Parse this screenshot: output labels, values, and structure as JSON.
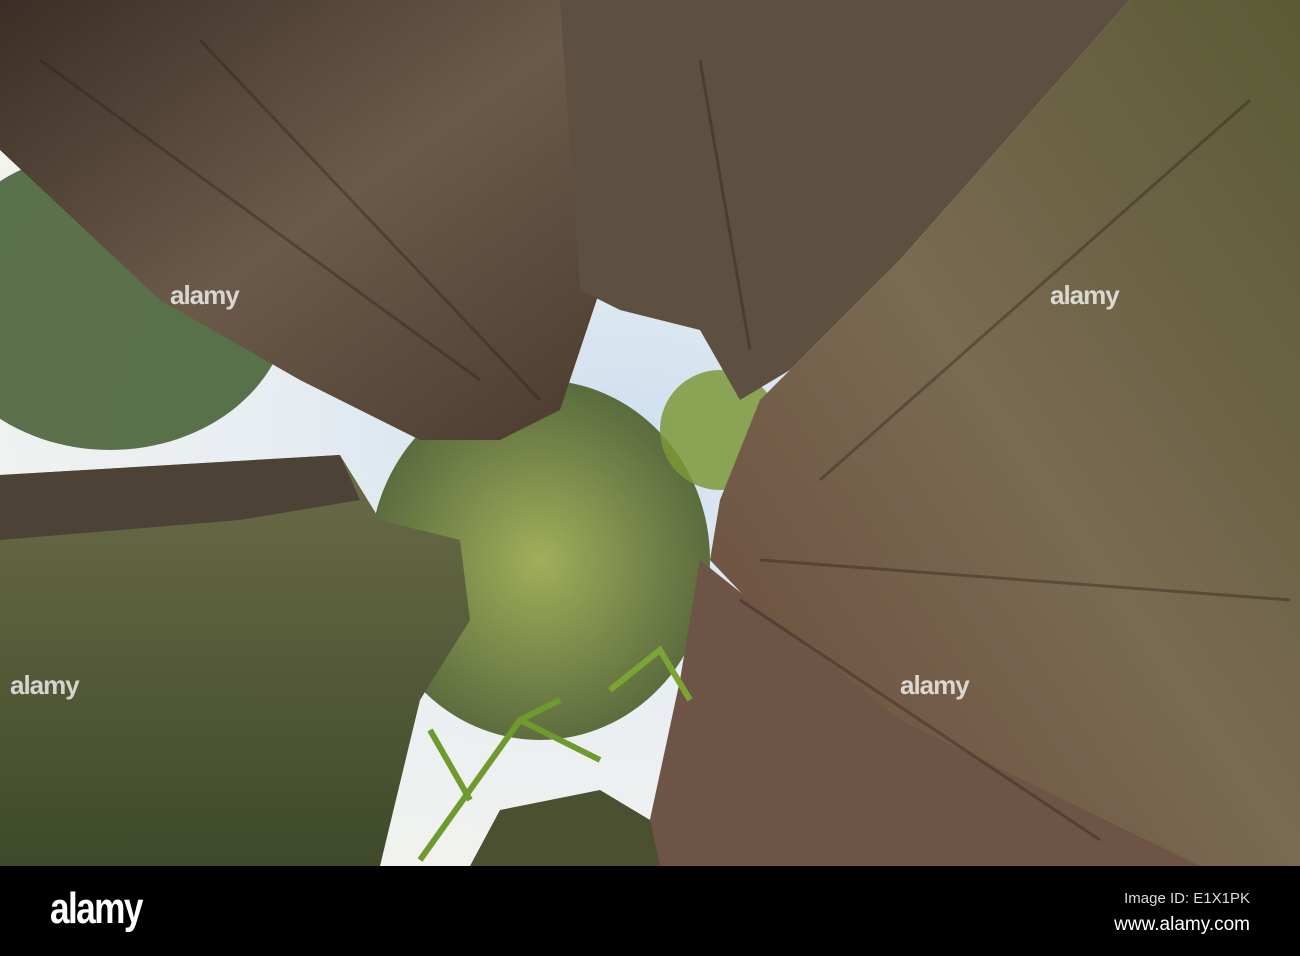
{
  "watermark": {
    "text": "alamy"
  },
  "footer": {
    "logo": "alamy",
    "image_id": "Image ID: E1X1PK",
    "url": "www.alamy.com"
  }
}
